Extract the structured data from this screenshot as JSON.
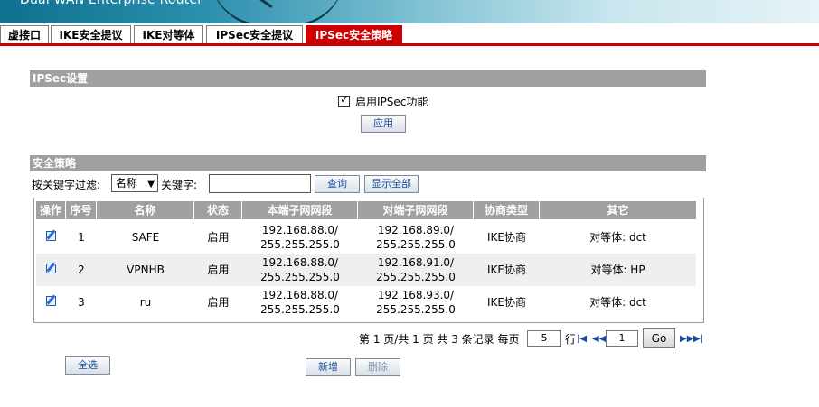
{
  "header": {
    "title": "Dual WAN Enterprise Router"
  },
  "tabs": [
    {
      "label": "虚接口",
      "active": false
    },
    {
      "label": "IKE安全提议",
      "active": false
    },
    {
      "label": "IKE对等体",
      "active": false
    },
    {
      "label": "IPSec安全提议",
      "active": false
    },
    {
      "label": "IPSec安全策略",
      "active": true
    }
  ],
  "ipsec_settings": {
    "section_title": "IPSec设置",
    "enable_label": "启用IPSec功能",
    "enabled": true,
    "apply_label": "应用"
  },
  "policy": {
    "section_title": "安全策略",
    "filter_label": "按关键字过滤:",
    "filter_select_value": "名称",
    "keyword_label": "关键字:",
    "keyword_value": "",
    "search_label": "查询",
    "show_all_label": "显示全部",
    "columns": [
      "操作",
      "序号",
      "名称",
      "状态",
      "本端子网网段",
      "对端子网网段",
      "协商类型",
      "其它"
    ],
    "rows": [
      {
        "index": "1",
        "name": "SAFE",
        "status": "启用",
        "local": "192.168.88.0/\n255.255.255.0",
        "remote": "192.168.89.0/\n255.255.255.0",
        "negotiation": "IKE协商",
        "other": "对等体: dct"
      },
      {
        "index": "2",
        "name": "VPNHB",
        "status": "启用",
        "local": "192.168.88.0/\n255.255.255.0",
        "remote": "192.168.91.0/\n255.255.255.0",
        "negotiation": "IKE协商",
        "other": "对等体: HP"
      },
      {
        "index": "3",
        "name": "ru",
        "status": "启用",
        "local": "192.168.88.0/\n255.255.255.0",
        "remote": "192.168.93.0/\n255.255.255.0",
        "negotiation": "IKE协商",
        "other": "对等体: dct"
      }
    ]
  },
  "pagination": {
    "summary": "第 1 页/共 1 页 共 3 条记录 每页",
    "per_page": "5",
    "rows_unit": "行",
    "page_input": "1",
    "go_label": "Go"
  },
  "actions": {
    "select_all_label": "全选",
    "add_label": "新增",
    "delete_label": "删除"
  }
}
